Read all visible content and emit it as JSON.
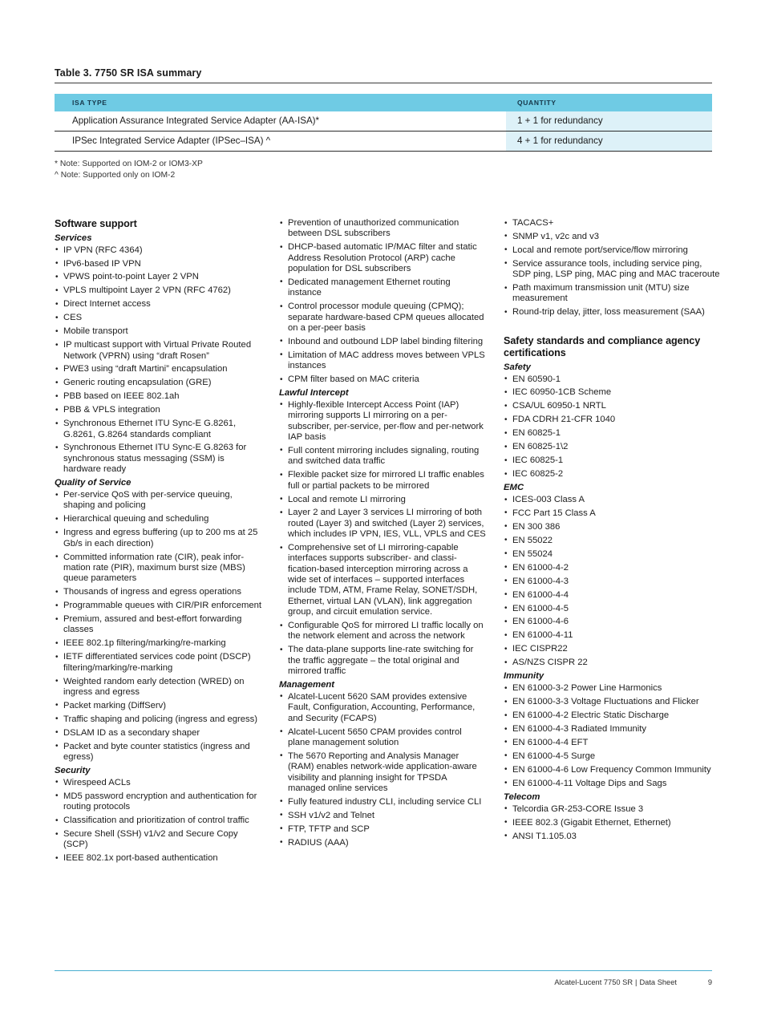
{
  "table": {
    "caption": "Table 3. 7750 SR ISA summary",
    "headers": [
      "ISA TYPE",
      "QUANTITY"
    ],
    "rows": [
      [
        "Application Assurance Integrated Service Adapter (AA-ISA)*",
        "1 + 1 for redundancy"
      ],
      [
        "IPSec Integrated Service Adapter (IPSec–ISA) ^",
        "4 + 1 for redundancy"
      ]
    ],
    "notes": [
      "* Note: Supported on IOM-2 or IOM3-XP",
      "^ Note: Supported only on IOM-2"
    ],
    "header_bg": "#6fcbe4",
    "qty_cell_bg": "#ddf1f8"
  },
  "column1": {
    "heading": "Software support",
    "groups": [
      {
        "subheading": "Services",
        "items": [
          "IP VPN (RFC 4364)",
          "IPv6-based IP VPN",
          "VPWS point-to-point Layer 2 VPN",
          "VPLS multipoint Layer 2 VPN (RFC 4762)",
          "Direct Internet access",
          "CES",
          "Mobile transport",
          "IP multicast support with Virtual Private Routed Network (VPRN) using “draft Rosen”",
          "PWE3 using “draft Martini” encapsulation",
          "Generic routing encapsulation (GRE)",
          "PBB based on IEEE 802.1ah",
          "PBB & VPLS integration",
          "Synchronous Ethernet ITU Sync-E G.8261, G.8261, G.8264 standards compliant",
          "Synchronous Ethernet ITU Sync-E G.8263 for synchronous status messaging (SSM) is hardware ready"
        ]
      },
      {
        "subheading": "Quality of Service",
        "items": [
          "Per-service QoS with per-service queuing, shaping and policing",
          "Hierarchical queuing and scheduling",
          "Ingress and egress buffering (up to 200 ms at 25 Gb/s in each direction)",
          "Committed information rate (CIR), peak infor-mation rate (PIR), maximum burst size (MBS) queue parameters",
          "Thousands of ingress and egress operations",
          "Programmable queues with CIR/PIR enforcement",
          "Premium, assured and best-effort forwarding classes",
          "IEEE 802.1p filtering/marking/re-marking",
          "IETF differentiated services code point (DSCP) filtering/marking/re-marking",
          "Weighted random early detection (WRED) on ingress and egress",
          "Packet marking (DiffServ)",
          "Traffic shaping and policing (ingress and egress)",
          "DSLAM ID as a secondary shaper",
          "Packet and byte counter statistics (ingress and egress)"
        ]
      },
      {
        "subheading": "Security",
        "items": [
          "Wirespeed ACLs",
          "MD5 password encryption and authentication for routing protocols",
          "Classification and prioritization of control traffic",
          "Secure Shell (SSH) v1/v2 and Secure Copy (SCP)",
          "IEEE 802.1x port-based authentication"
        ]
      }
    ]
  },
  "column2": {
    "groups": [
      {
        "subheading": "",
        "items": [
          "Prevention of unauthorized communication between DSL subscribers",
          "DHCP-based automatic IP/MAC filter and static Address Resolution Protocol (ARP) cache population for DSL subscribers",
          "Dedicated management Ethernet routing instance",
          "Control processor module queuing (CPMQ); separate hardware-based CPM queues allocated on a per-peer basis",
          "Inbound and outbound LDP label binding filtering",
          "Limitation of MAC address moves between VPLS instances",
          "CPM filter based on MAC criteria"
        ]
      },
      {
        "subheading": "Lawful Intercept",
        "items": [
          "Highly-flexible Intercept Access Point (IAP) mirroring supports LI mirroring on a per-subscriber, per-service, per-flow and per-network IAP basis",
          "Full content mirroring includes signaling, routing and switched data traffic",
          "Flexible packet size for mirrored LI traffic enables full or partial packets to be mirrored",
          "Local and remote LI mirroring",
          "Layer 2 and Layer 3 services LI mirroring of both routed (Layer 3) and switched (Layer 2) services, which includes IP VPN, IES, VLL, VPLS and CES",
          "Comprehensive set of LI mirroring-capable interfaces supports subscriber- and classi-fication-based interception mirroring across a wide set of interfaces – supported interfaces include TDM, ATM, Frame Relay, SONET/SDH, Ethernet, virtual LAN (VLAN), link aggregation group, and circuit emulation service.",
          "Configurable QoS for mirrored LI traffic locally on the network element and across the network",
          "The data-plane supports line-rate switching for the traffic aggregate – the total original and mirrored traffic"
        ]
      },
      {
        "subheading": "Management",
        "items": [
          "Alcatel-Lucent 5620 SAM provides extensive Fault, Configuration, Accounting, Performance, and Security (FCAPS)",
          "Alcatel-Lucent 5650 CPAM provides control plane management solution",
          "The 5670 Reporting and Analysis Manager (RAM) enables network-wide application-aware visibility and planning insight for TPSDA managed online services",
          "Fully featured industry CLI, including service CLI",
          "SSH v1/v2 and Telnet",
          "FTP, TFTP and SCP",
          "RADIUS (AAA)"
        ]
      }
    ]
  },
  "column3": {
    "top_items": [
      "TACACS+",
      "SNMP v1, v2c and v3",
      "Local and remote port/service/flow mirroring",
      "Service assurance tools, including service ping, SDP ping, LSP ping, MAC ping and MAC traceroute",
      "Path maximum transmission unit (MTU) size measurement",
      "Round-trip delay, jitter, loss measurement (SAA)"
    ],
    "heading": "Safety standards and compliance agency certifications",
    "groups": [
      {
        "subheading": "Safety",
        "items": [
          "EN 60590-1",
          "IEC 60950-1CB Scheme",
          "CSA/UL 60950-1 NRTL",
          "FDA CDRH 21-CFR 1040",
          "EN 60825-1",
          "EN 60825-1\\2",
          "IEC 60825-1",
          "IEC 60825-2"
        ]
      },
      {
        "subheading": "EMC",
        "items": [
          "ICES-003 Class A",
          "FCC Part 15 Class A",
          "EN 300 386",
          "EN 55022",
          "EN 55024",
          "EN 61000-4-2",
          "EN 61000-4-3",
          "EN 61000-4-4",
          "EN 61000-4-5",
          "EN 61000-4-6",
          "EN 61000-4-11",
          "IEC CISPR22",
          "AS/NZS CISPR 22"
        ]
      },
      {
        "subheading": "Immunity",
        "items": [
          "EN 61000-3-2 Power Line Harmonics",
          "EN 61000-3-3 Voltage Fluctuations and Flicker",
          "EN 61000-4-2 Electric Static Discharge",
          "EN 61000-4-3 Radiated Immunity",
          "EN 61000-4-4 EFT",
          "EN 61000-4-5 Surge",
          "EN 61000-4-6 Low Frequency Common Immunity",
          "EN 61000-4-11 Voltage Dips and Sags"
        ]
      },
      {
        "subheading": "Telecom",
        "items": [
          "Telcordia GR-253-CORE Issue 3",
          "IEEE 802.3 (Gigabit Ethernet, Ethernet)",
          "ANSI T1.105.03"
        ]
      }
    ]
  },
  "footer": {
    "document": "Alcatel-Lucent 7750 SR",
    "separator": "|",
    "type": "Data Sheet",
    "page_number": "9",
    "rule_color": "#4aaed0"
  }
}
